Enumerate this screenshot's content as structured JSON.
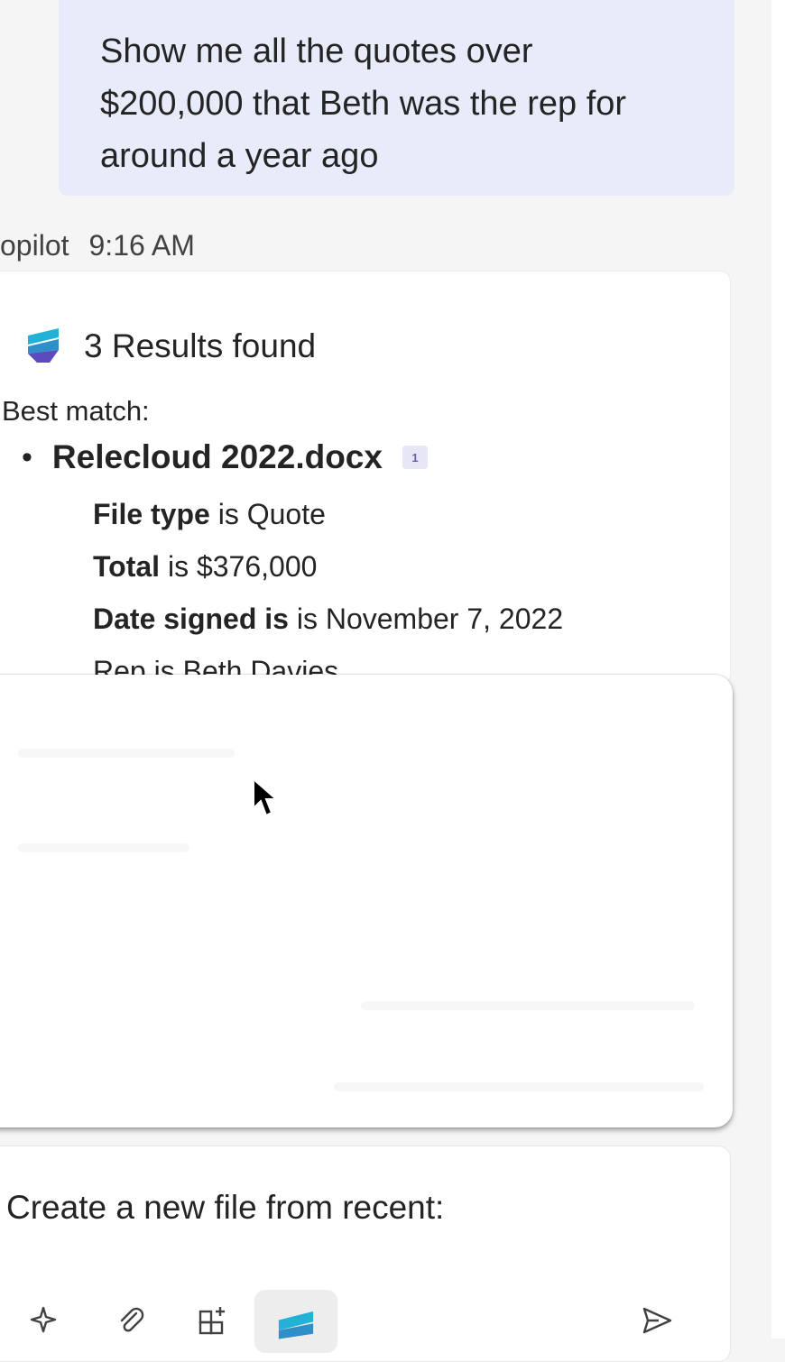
{
  "user_message": {
    "line1": "Show me all the quotes over",
    "line2": "$200,000 that Beth was the rep for",
    "line3": "around a year ago"
  },
  "response_meta": {
    "sender": "opilot",
    "time": "9:16 AM"
  },
  "result_card": {
    "results_label": "3 Results found",
    "best_match_label": "Best match:",
    "file": {
      "name": "Relecloud 2022.docx",
      "citation": "1",
      "facts": [
        {
          "key": "File type",
          "value": " is Quote"
        },
        {
          "key": "Total",
          "value": " is $376,000"
        },
        {
          "key": "Date signed is",
          "value": " is November 7, 2022"
        },
        {
          "key": "",
          "value": "Rep is Beth Davies"
        }
      ]
    }
  },
  "composer": {
    "text": "Create a new file from recent:",
    "tools": [
      "sparkle-icon",
      "paperclip-icon",
      "add-app-icon",
      "syntex-icon",
      "send-icon"
    ]
  },
  "colors": {
    "bubble": "#e8ebfa",
    "accent_teal": "#1fa9c9",
    "accent_purple": "#5b4bbd",
    "citation": "#6264a7"
  }
}
